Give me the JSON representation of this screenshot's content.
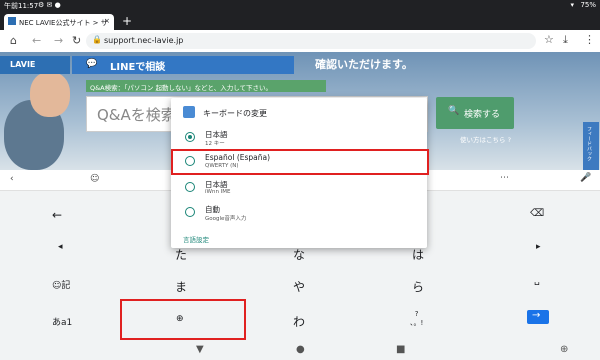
{
  "status": {
    "time": "午前11:57",
    "battery": "75%"
  },
  "browser": {
    "tab_title": "NEC LAVIE公式サイト > サ",
    "url": "support.nec-lavie.jp"
  },
  "page": {
    "logo": "LAVIE",
    "line_label": "LINEで相談",
    "confirm_text": "確認いただけます。",
    "qa_banner": "Q&A検索：「パソコン 起動しない」などと、入力して下さい。",
    "search_placeholder": "Q&Aを検索",
    "search_button": "検索する",
    "howto": "使い方はこちら",
    "feedback": "フィードバック"
  },
  "dialog": {
    "title": "キーボードの変更",
    "options": [
      {
        "name": "日本語",
        "sub": "12 キー",
        "selected": true
      },
      {
        "name": "Español (España)",
        "sub": "QWERTY (N)",
        "selected": false
      },
      {
        "name": "日本語",
        "sub": "iWnn IME",
        "selected": false
      },
      {
        "name": "自動",
        "sub": "Google音声入力",
        "selected": false
      }
    ],
    "settings_link": "言語設定"
  },
  "keyboard": {
    "keys": [
      "た",
      "な",
      "は",
      "ま",
      "や",
      "ら",
      "わ"
    ],
    "side_left": [
      "←",
      "◂",
      "☺記",
      "あa1"
    ],
    "enter": "→"
  },
  "colors": {
    "accent": "#1a8577",
    "highlight": "#e02020",
    "enter": "#1a73e8"
  }
}
